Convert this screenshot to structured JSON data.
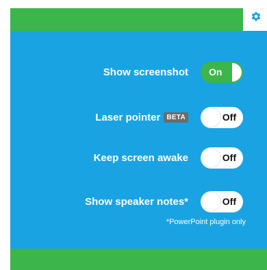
{
  "settings": {
    "items": [
      {
        "label": "Show screenshot",
        "state": "On"
      },
      {
        "label": "Laser pointer",
        "badge": "BETA",
        "state": "Off"
      },
      {
        "label": "Keep screen awake",
        "state": "Off"
      },
      {
        "label": "Show speaker notes*",
        "state": "Off"
      }
    ],
    "footnote": "*PowerPoint plugin only"
  },
  "icons": {
    "settings": "gear-icon"
  },
  "colors": {
    "panel": "#1aa3e2",
    "bars": "#3cb54a",
    "toggle_on": "#3cb54a",
    "toggle_off": "#ffffff",
    "badge": "#6b6b6b"
  }
}
